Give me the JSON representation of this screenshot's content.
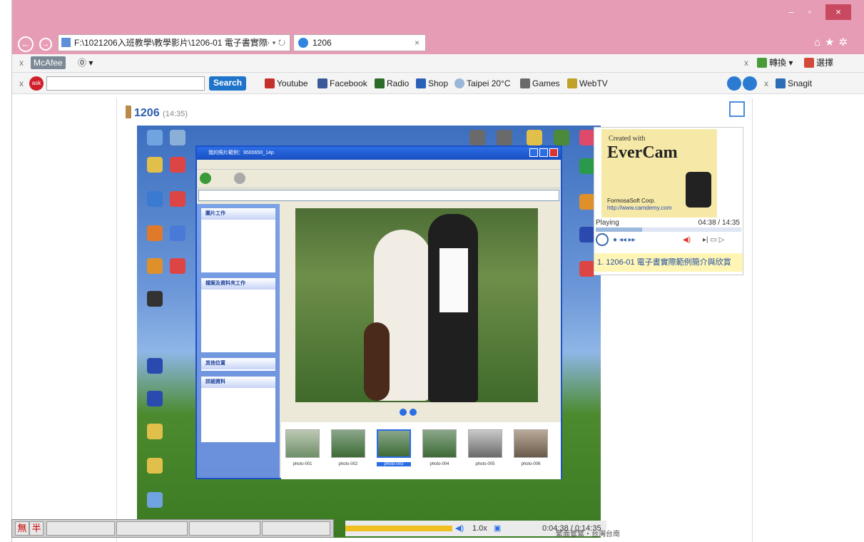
{
  "browser": {
    "address": "F:\\1021206入班教學\\教學影片\\1206-01 電子書實際",
    "tab_title": "1206",
    "back_label": "←",
    "forward_label": "→",
    "minimize": "–",
    "restore": "▫",
    "close": "×",
    "icons": [
      "home-icon",
      "star-icon",
      "gear-icon"
    ]
  },
  "toolbars": {
    "mcafee": {
      "label": "McAfee"
    },
    "right_1": {
      "convert": "轉換",
      "select": "選擇"
    },
    "search_button": "Search",
    "links": [
      "Youtube",
      "Facebook",
      "Radio",
      "Shop",
      "Taipei 20°C",
      "Games",
      "WebTV"
    ],
    "snagit": "Snagit"
  },
  "page": {
    "title": "1206",
    "duration": "(14:35)"
  },
  "player": {
    "evercam": {
      "created_with": "Created with",
      "brand": "EverCam",
      "company": "FormosaSoft Corp.",
      "url": "http://www.camdemy.com"
    },
    "status": "Playing",
    "time": "04:38 / 14:35",
    "playlist_item": "1. 1206-01 電子書實際範例簡介與欣賞",
    "speed": "1.0x",
    "position": "0:04:38 / 0:14:35"
  },
  "video": {
    "explorer_title": "我的照片範例：9500650_14p",
    "tasks": [
      "圖片工作",
      "檔案及資料夾工作",
      "其他位置",
      "詳細資料"
    ],
    "thumbs": [
      "photo-001",
      "photo-002",
      "photo-003",
      "photo-004",
      "photo-005",
      "photo-006"
    ]
  },
  "ime": {
    "mode1": "無",
    "mode2": "半"
  },
  "footer": {
    "caption": "繁面鷺鷥・台灣台南"
  }
}
